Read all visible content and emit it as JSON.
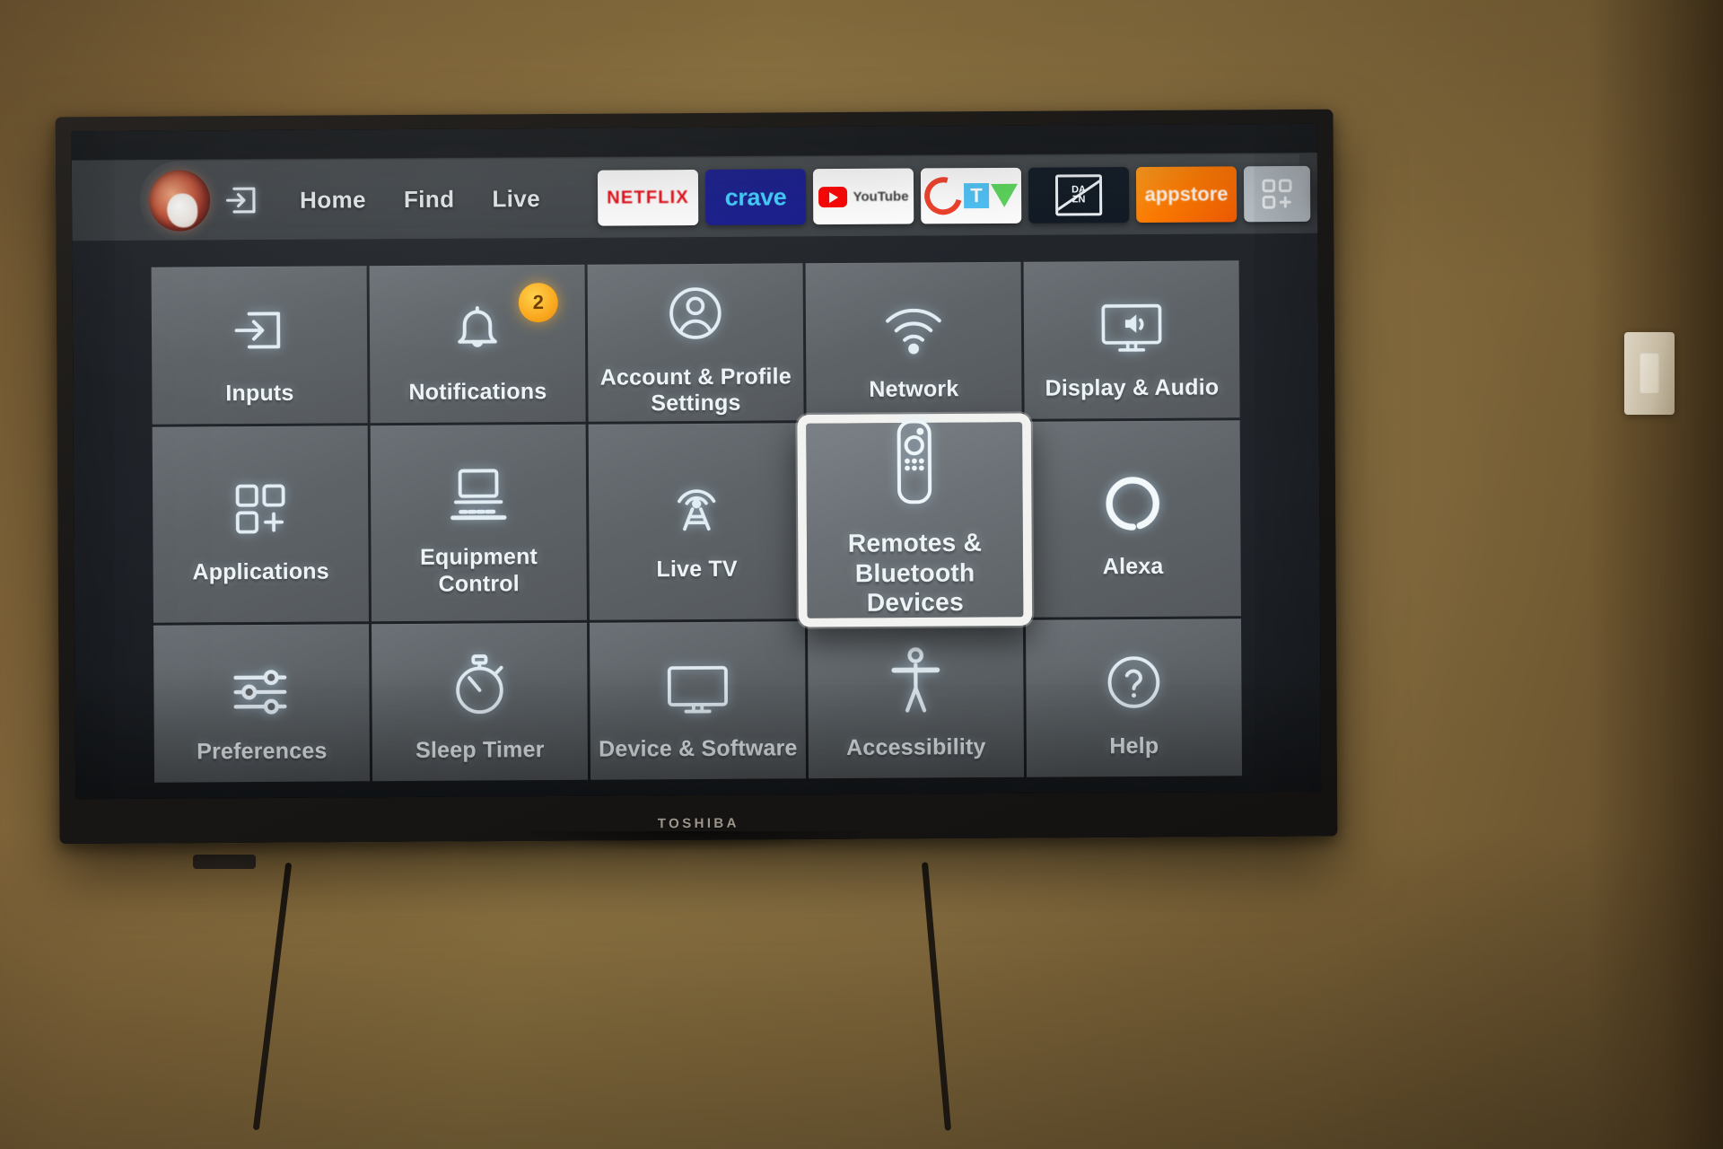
{
  "device": {
    "brand": "TOSHIBA"
  },
  "topnav": {
    "avatar_name": "profile-avatar",
    "inputs_icon": "inputs-icon",
    "links": [
      {
        "label": "Home"
      },
      {
        "label": "Find"
      },
      {
        "label": "Live"
      }
    ],
    "apps": [
      {
        "name": "netflix",
        "label": "NETFLIX"
      },
      {
        "name": "crave",
        "label": "crave"
      },
      {
        "name": "youtube",
        "label": "YouTube"
      },
      {
        "name": "ctv",
        "label": "CTV"
      },
      {
        "name": "dazn",
        "label": "DAZN"
      },
      {
        "name": "appstore",
        "label": "appstore"
      }
    ],
    "apps_grid_label": "apps-grid",
    "settings_label": "settings-gear"
  },
  "grid": {
    "tiles": [
      {
        "label": "Inputs",
        "icon": "inputs-icon",
        "selected": false
      },
      {
        "label": "Notifications",
        "icon": "bell-icon",
        "selected": false,
        "badge": "2"
      },
      {
        "label": "Account & Profile Settings",
        "icon": "person-circle-icon",
        "selected": false
      },
      {
        "label": "Network",
        "icon": "wifi-icon",
        "selected": false
      },
      {
        "label": "Display & Audio",
        "icon": "tv-speaker-icon",
        "selected": false
      },
      {
        "label": "Applications",
        "icon": "apps-grid-plus-icon",
        "selected": false
      },
      {
        "label": "Equipment Control",
        "icon": "monitor-keyboard-icon",
        "selected": false
      },
      {
        "label": "Live TV",
        "icon": "broadcast-tower-icon",
        "selected": false
      },
      {
        "label": "Remotes & Bluetooth Devices",
        "icon": "remote-control-icon",
        "selected": true
      },
      {
        "label": "Alexa",
        "icon": "alexa-ring-icon",
        "selected": false
      },
      {
        "label": "Preferences",
        "icon": "sliders-icon",
        "selected": false
      },
      {
        "label": "Sleep Timer",
        "icon": "stopwatch-icon",
        "selected": false
      },
      {
        "label": "Device & Software",
        "icon": "tv-icon",
        "selected": false
      },
      {
        "label": "Accessibility",
        "icon": "accessibility-icon",
        "selected": false
      },
      {
        "label": "Help",
        "icon": "question-circle-icon",
        "selected": false
      }
    ]
  },
  "colors": {
    "badge": "#f9a61a",
    "tile": "#5d6367",
    "selected_border": "#f2f3f0",
    "nav_bar": "#3e4347",
    "wall": "#8a6d3e"
  }
}
